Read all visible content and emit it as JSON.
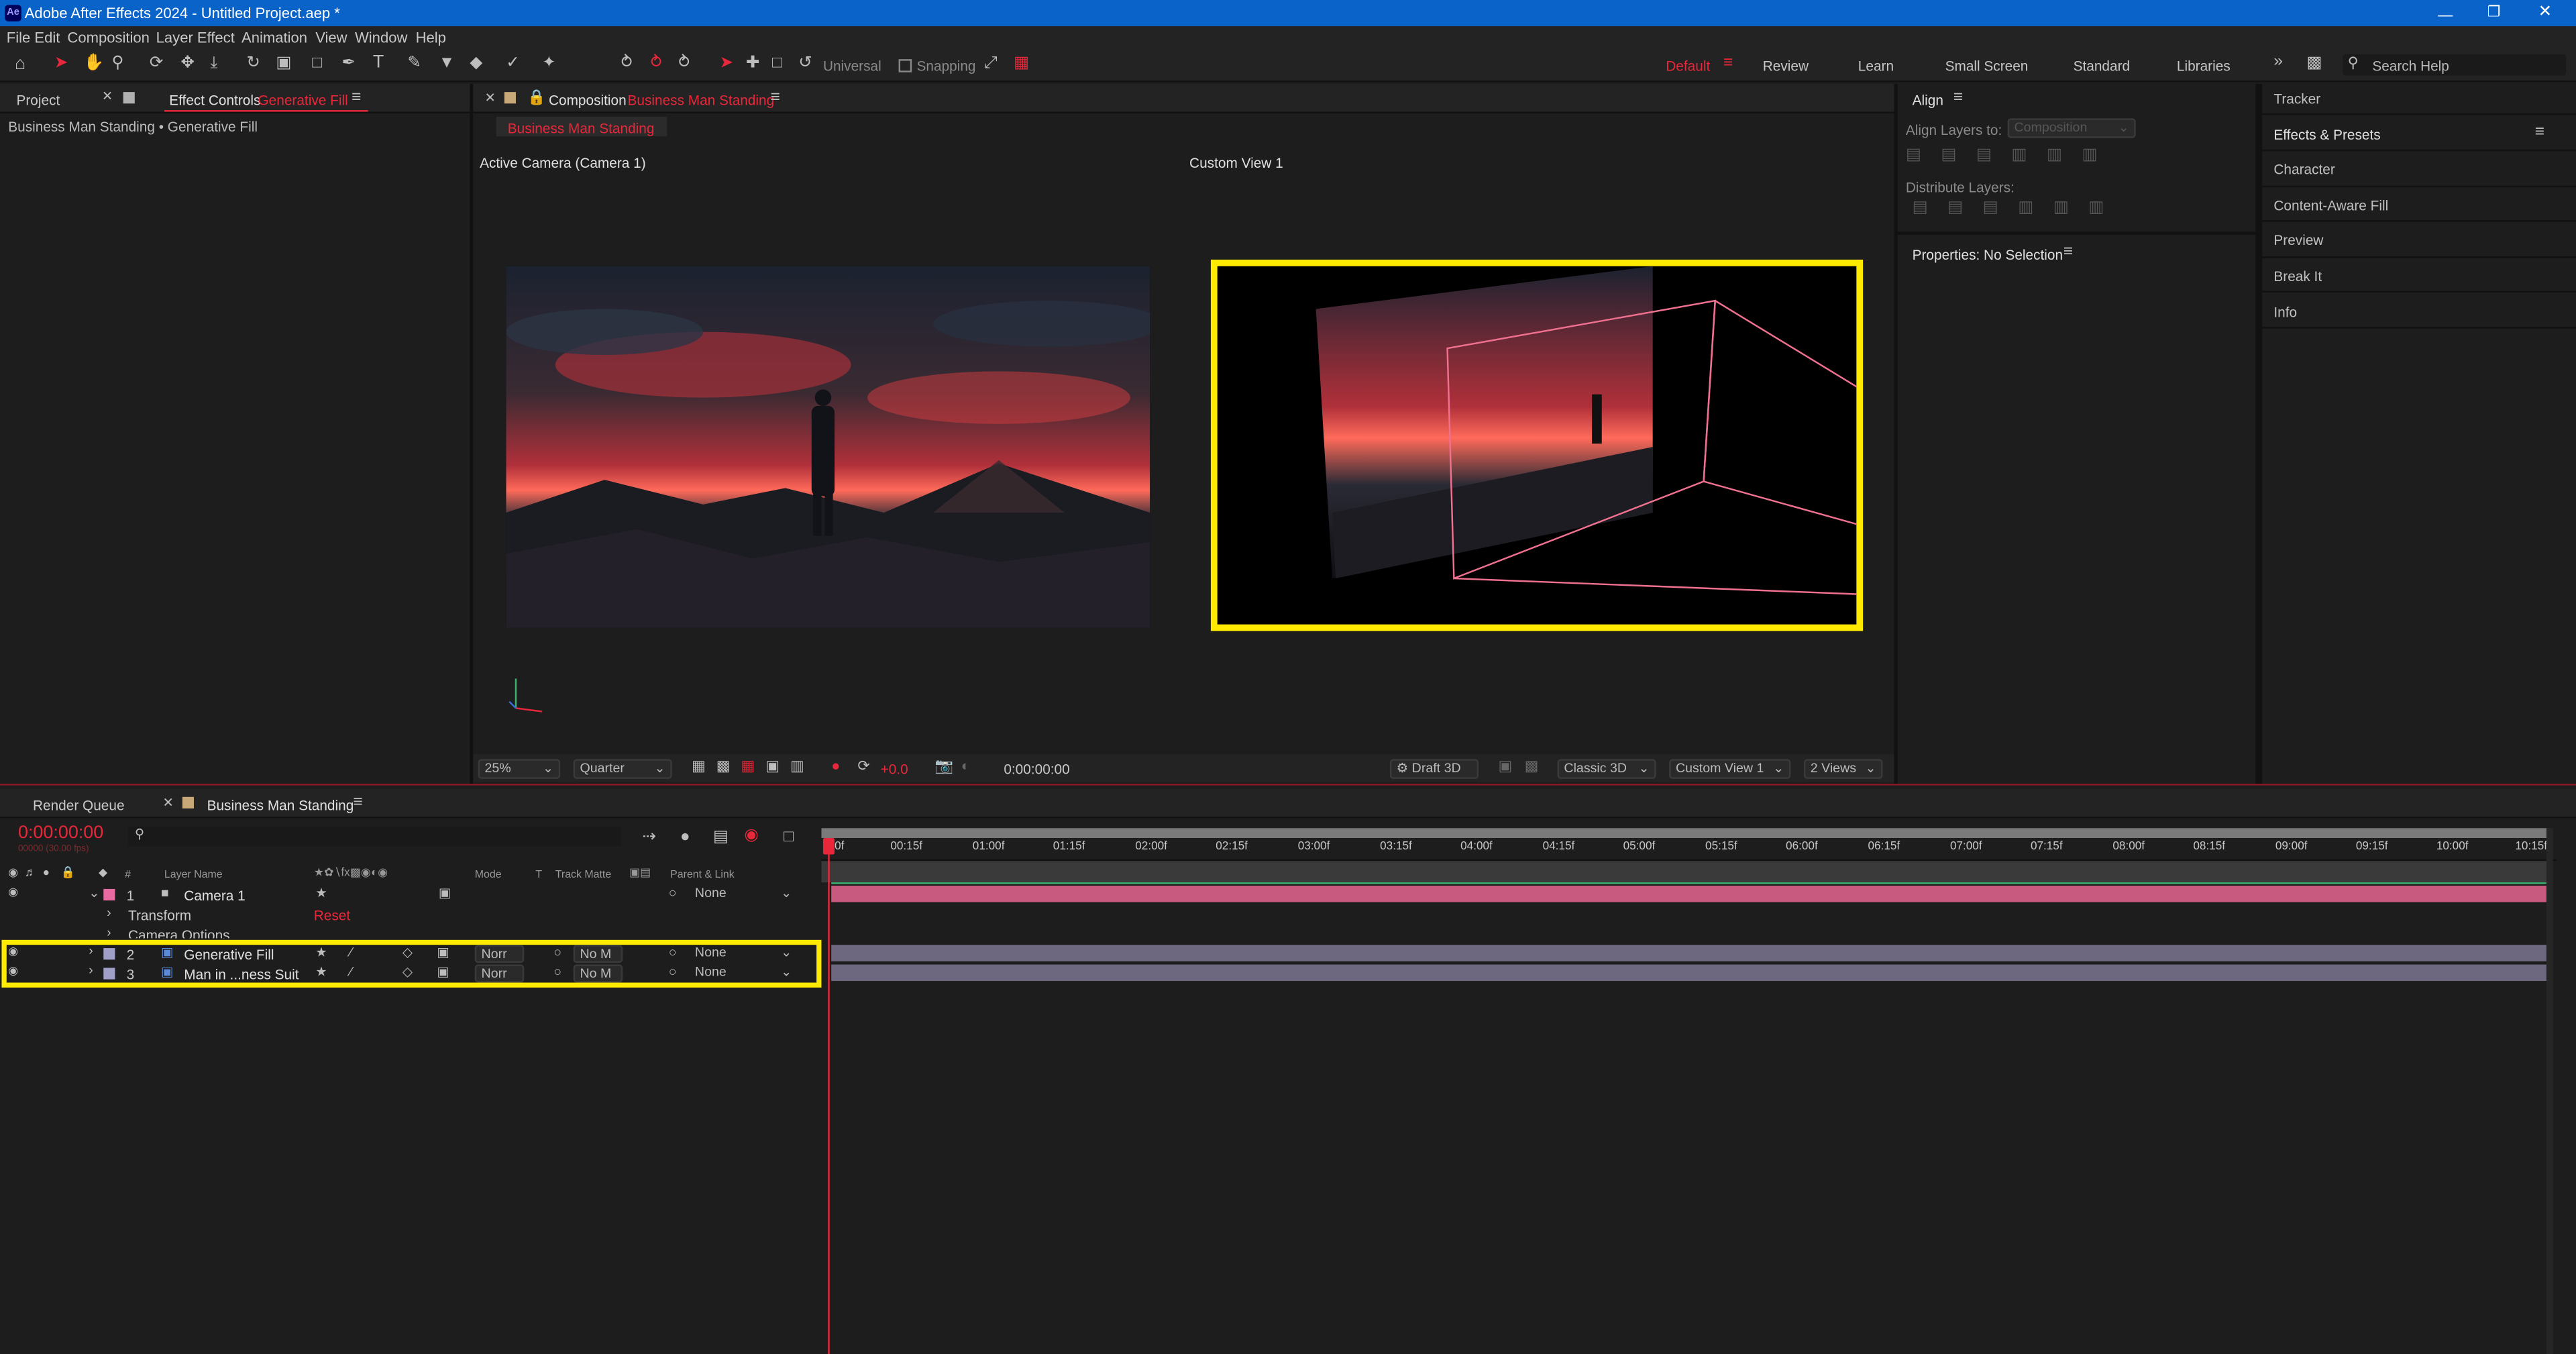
{
  "window": {
    "title": "Adobe After Effects 2024 - Untitled Project.aep *",
    "app_icon": "Ae"
  },
  "menu": [
    "File",
    "Edit",
    "Composition",
    "Layer",
    "Effect",
    "Animation",
    "View",
    "Window",
    "Help"
  ],
  "toolbar": {
    "universal_label": "Universal",
    "snapping_label": "Snapping"
  },
  "workspaces": {
    "items": [
      "Default",
      "Review",
      "Learn",
      "Small Screen",
      "Standard",
      "Libraries"
    ],
    "active": "Default",
    "search_placeholder": "Search Help"
  },
  "left_panel": {
    "tab_project": "Project",
    "tab_effect_controls": "Effect Controls",
    "effect_controls_layer": "Generative Fill",
    "breadcrumb": "Business Man Standing • Generative Fill"
  },
  "composition": {
    "tab_label": "Composition",
    "comp_name": "Business Man Standing",
    "flow_tab": "Business Man Standing",
    "view_left": "Active Camera (Camera 1)",
    "view_right": "Custom View 1"
  },
  "viewer_bottom": {
    "zoom": "25%",
    "resolution": "Quarter",
    "exposure": "+0.0",
    "timecode": "0:00:00:00",
    "renderer": "Draft 3D",
    "view_layout_3d": "Classic 3D",
    "camera_view": "Custom View 1",
    "views": "2 Views"
  },
  "align": {
    "title": "Align",
    "align_to_label": "Align Layers to:",
    "align_to_value": "Composition",
    "distribute_label": "Distribute Layers:"
  },
  "properties": {
    "title": "Properties: No Selection"
  },
  "right_panel": {
    "items": [
      "Tracker",
      "Effects & Presets",
      "Character",
      "Content-Aware Fill",
      "Preview",
      "Break It",
      "Info"
    ]
  },
  "timeline": {
    "tab_render_queue": "Render Queue",
    "tab_comp": "Business Man Standing",
    "timecode": "0:00:00:00",
    "timecode_sub": "00000 (30.00 fps)",
    "search_placeholder": "",
    "headers": {
      "num": "#",
      "layer_name": "Layer Name",
      "mode": "Mode",
      "t": "T",
      "track_matte": "Track Matte",
      "parent": "Parent & Link"
    },
    "layers": [
      {
        "num": "1",
        "name": "Camera 1",
        "parent": "None",
        "color": "#e86aa0"
      },
      {
        "num": "2",
        "name": "Generative Fill",
        "mode": "Norr",
        "matte": "No M",
        "parent": "None",
        "color": "#9f9fc8"
      },
      {
        "num": "3",
        "name": "Man in ...ness Suit",
        "mode": "Norr",
        "matte": "No M",
        "parent": "None",
        "color": "#9f9fc8"
      }
    ],
    "sub_rows": [
      {
        "label": "Transform",
        "value": "Reset"
      },
      {
        "label": "Camera Options"
      }
    ],
    "ruler": [
      "0f",
      "00:15f",
      "01:00f",
      "01:15f",
      "02:00f",
      "02:15f",
      "03:00f",
      "03:15f",
      "04:00f",
      "04:15f",
      "05:00f",
      "05:15f",
      "06:00f",
      "06:15f",
      "07:00f",
      "07:15f",
      "08:00f",
      "08:15f",
      "09:00f",
      "09:15f",
      "10:00f",
      "10:15f"
    ]
  },
  "colors": {
    "accent_red": "#e8283a",
    "highlight_yellow": "#ffea00",
    "title_blue": "#0a63c8",
    "camera_label": "#e86aa0",
    "layer_label": "#9f9fc8"
  }
}
